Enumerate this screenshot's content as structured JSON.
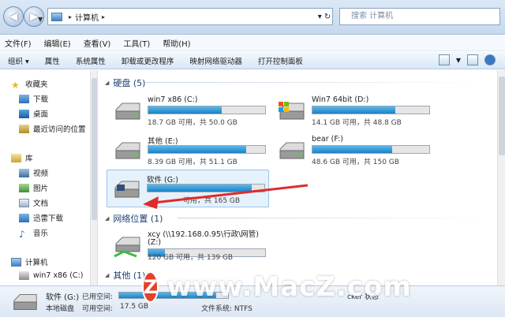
{
  "address": {
    "path_label": "计算机",
    "search_placeholder": "搜索 计算机"
  },
  "menu": [
    "文件(F)",
    "编辑(E)",
    "查看(V)",
    "工具(T)",
    "帮助(H)"
  ],
  "toolbar": {
    "organize": "组织 ▾",
    "items": [
      "属性",
      "系统属性",
      "卸载或更改程序",
      "映射网络驱动器",
      "打开控制面板"
    ]
  },
  "nav": {
    "favorites": "收藏夹",
    "downloads": "下载",
    "desktop": "桌面",
    "recent": "最近访问的位置",
    "libraries": "库",
    "videos": "视频",
    "pictures": "图片",
    "documents": "文档",
    "thunder": "迅雷下载",
    "music": "音乐",
    "computer": "计算机",
    "c_drive": "win7 x86 (C:)"
  },
  "groups": {
    "hdd": "硬盘 (5)",
    "network": "网络位置 (1)",
    "other": "其他 (1)"
  },
  "drives": [
    {
      "name": "win7 x86 (C:)",
      "size": "18.7 GB 可用，共 50.0 GB",
      "used": 0.63
    },
    {
      "name": "Win7 64bit  (D:)",
      "size": "14.1 GB 可用，共 48.8 GB",
      "used": 0.71
    },
    {
      "name": "其他 (E:)",
      "size": "8.39 GB 可用，共 51.1 GB",
      "used": 0.84
    },
    {
      "name": "bear (F:)",
      "size": "48.6 GB 可用，共 150 GB",
      "used": 0.68
    },
    {
      "name": "软件 (G:)",
      "size": "可用，共 165 GB",
      "used": 0.89
    }
  ],
  "network_drive": {
    "name": "xcy (\\\\192.168.0.95\\行政\\网管)",
    "letter": "(Z:)",
    "size": "120 GB 可用，共 139 GB",
    "used": 0.14
  },
  "details": {
    "name": "软件 (G:)",
    "type": "本地磁盘",
    "used_label": "已用空间:",
    "free_label": "可用空间:",
    "free_value": "17.5 GB",
    "fs_label": "文件系统: NTFS",
    "extra": "cker 状态",
    "used": 0.89
  },
  "watermark": {
    "logo": "Z",
    "text": "www.MacZ.com"
  },
  "colors": {
    "bar_fill": "#1c82c7",
    "selection": "#e5f1fb",
    "arrow": "#e02a2a"
  }
}
